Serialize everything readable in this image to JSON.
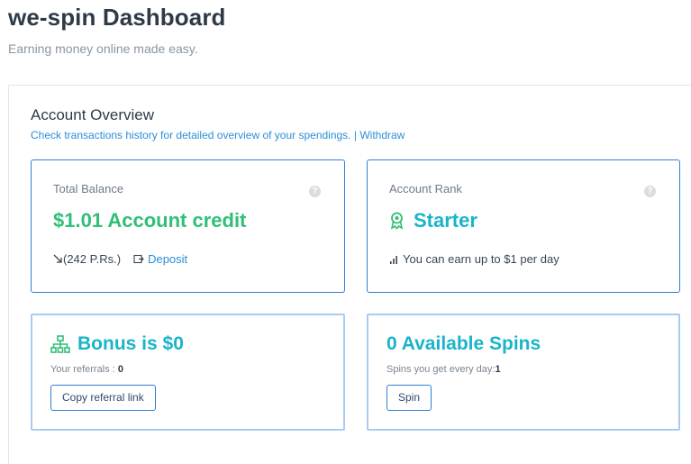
{
  "header": {
    "title": "we-spin Dashboard",
    "subtitle": "Earning money online made easy."
  },
  "overview": {
    "title": "Account Overview",
    "history_link": "Check transactions history for detailed overview of your spendings.",
    "separator": "|",
    "withdraw_link": "Withdraw"
  },
  "balance_card": {
    "label": "Total Balance",
    "amount": "$1.01",
    "amount_suffix": "Account credit",
    "pr_value": "(242 P.Rs.)",
    "deposit_label": "Deposit",
    "help_glyph": "?"
  },
  "rank_card": {
    "label": "Account Rank",
    "rank": "Starter",
    "earn_text": "You can earn up to $1 per day",
    "help_glyph": "?"
  },
  "bonus_card": {
    "title": "Bonus is $0",
    "referrals_label": "Your referrals :",
    "referrals_count": "0",
    "button_label": "Copy referral link"
  },
  "spins_card": {
    "title": "0 Available Spins",
    "per_day_label": "Spins you get every day:",
    "per_day_count": "1",
    "button_label": "Spin"
  },
  "colors": {
    "accent_blue": "#2f7fd6",
    "link_blue": "#2b8ed8",
    "green": "#2fbf77",
    "teal": "#19b4c9"
  },
  "icons": [
    "help-icon",
    "trend-down-icon",
    "deposit-icon",
    "award-ribbon-icon",
    "signal-bars-icon",
    "sitemap-icon"
  ]
}
